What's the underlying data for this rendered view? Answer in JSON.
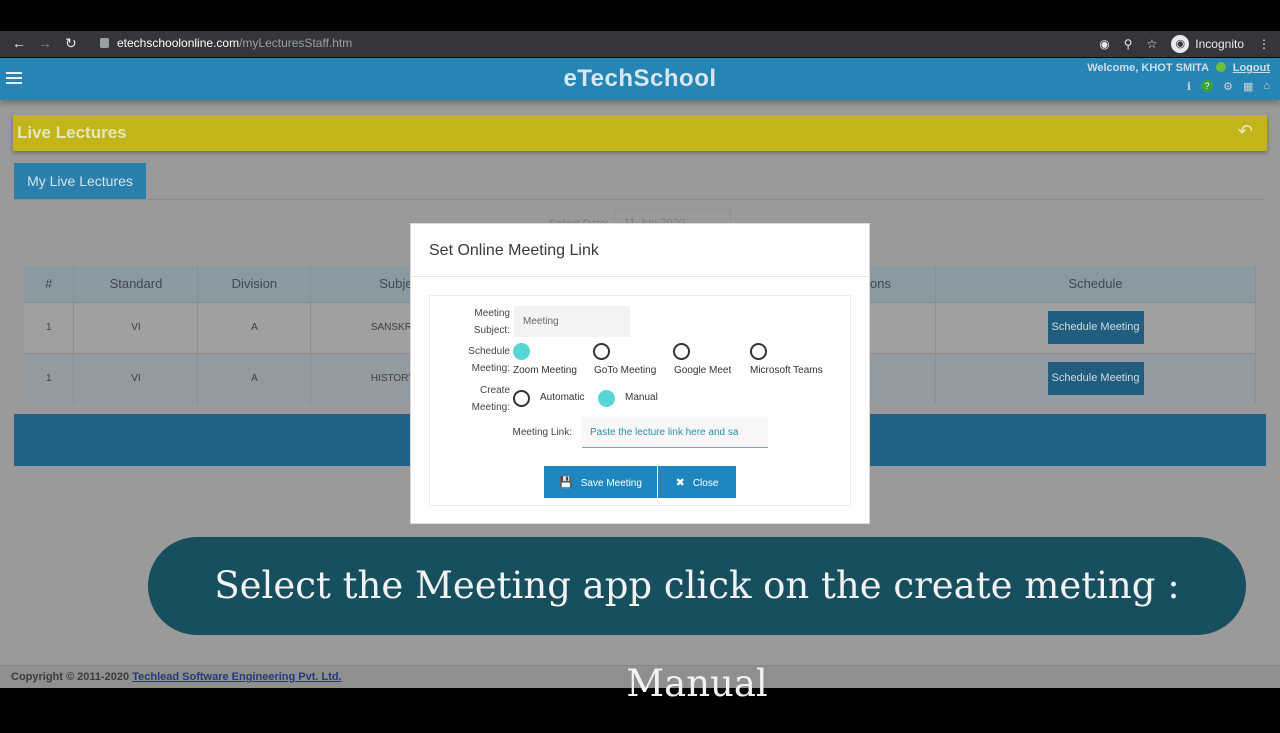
{
  "browser": {
    "url_domain": "etechschoolonline.com",
    "url_path": "/myLecturesStaff.htm",
    "profile_label": "Incognito",
    "nav_icons": [
      "back-icon",
      "forward-icon",
      "reload-icon"
    ]
  },
  "header": {
    "brand": "eTechSchool",
    "welcome": "Welcome, KHOT SMITA",
    "logout": "Logout"
  },
  "section": {
    "title": "Live Lectures",
    "tab_label": "My Live Lectures",
    "select_date_label": "Select Date:",
    "select_date_value": "11-Jun-2020"
  },
  "table": {
    "headers": [
      "#",
      "Standard",
      "Division",
      "Subje",
      "Options",
      "Schedule"
    ],
    "rows": [
      {
        "num": "1",
        "standard": "VI",
        "division": "A",
        "subject": "SANSKRIT",
        "options": "-",
        "schedule_label": "Schedule Meeting"
      },
      {
        "num": "1",
        "standard": "VI",
        "division": "A",
        "subject": "HISTORY (",
        "options": "-",
        "schedule_label": "Schedule Meeting"
      }
    ]
  },
  "modal": {
    "title": "Set Online Meeting Link",
    "subject_label_1": "Meeting",
    "subject_label_2": "Subject:",
    "subject_value": "Meeting",
    "schedule_label_1": "Schedule",
    "schedule_label_2": "Meeting:",
    "apps": [
      {
        "label": "Zoom Meeting",
        "selected": true
      },
      {
        "label": "GoTo Meeting",
        "selected": false
      },
      {
        "label": "Google Meet",
        "selected": false
      },
      {
        "label": "Microsoft Teams",
        "selected": false
      }
    ],
    "create_label_1": "Create",
    "create_label_2": "Meeting:",
    "create_options": [
      {
        "label": "Automatic",
        "selected": false
      },
      {
        "label": "Manual",
        "selected": true
      }
    ],
    "link_label": "Meeting Link:",
    "link_placeholder": "Paste the lecture link here and sa",
    "save_label": "Save Meeting",
    "close_label": "Close"
  },
  "caption": "Select the Meeting app click on the create meting : Manual",
  "footer": {
    "copyright": "Copyright © 2011-2020",
    "company": "Techlead Software Engineering Pvt. Ltd."
  },
  "colors": {
    "topbar": "#2586b6",
    "section_bar": "#c3b519",
    "accent_radio": "#58d6d3",
    "modal_button": "#1f87c0",
    "caption_bg": "#174f5e"
  }
}
